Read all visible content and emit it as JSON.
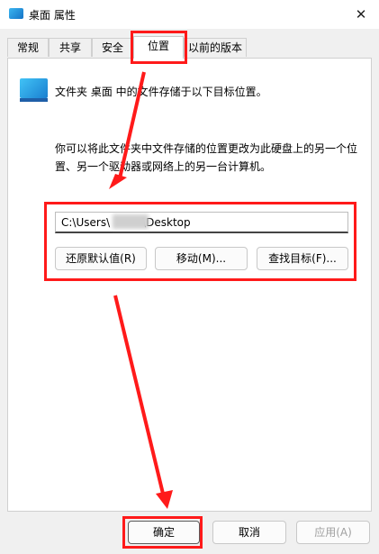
{
  "window": {
    "title": "桌面 属性",
    "close_symbol": "✕"
  },
  "tabs": [
    {
      "label": "常规"
    },
    {
      "label": "共享"
    },
    {
      "label": "安全"
    },
    {
      "label": "位置"
    },
    {
      "label": "以前的版本"
    }
  ],
  "location": {
    "info_text": "文件夹 桌面 中的文件存储于以下目标位置。",
    "description": "你可以将此文件夹中文件存储的位置更改为此硬盘上的另一个位置、另一个驱动器或网络上的另一台计算机。",
    "path_value": "C:\\Users\\　　　\\Desktop",
    "restore_label": "还原默认值(R)",
    "move_label": "移动(M)...",
    "find_label": "查找目标(F)..."
  },
  "footer": {
    "ok_label": "确定",
    "cancel_label": "取消",
    "apply_label": "应用(A)"
  },
  "icons": {
    "title_icon": "desktop-folder-icon",
    "folder_icon": "desktop-folder-icon",
    "close_icon": "close-icon"
  },
  "colors": {
    "highlight": "#ff1a1a",
    "folder": "#1a7fd0"
  }
}
